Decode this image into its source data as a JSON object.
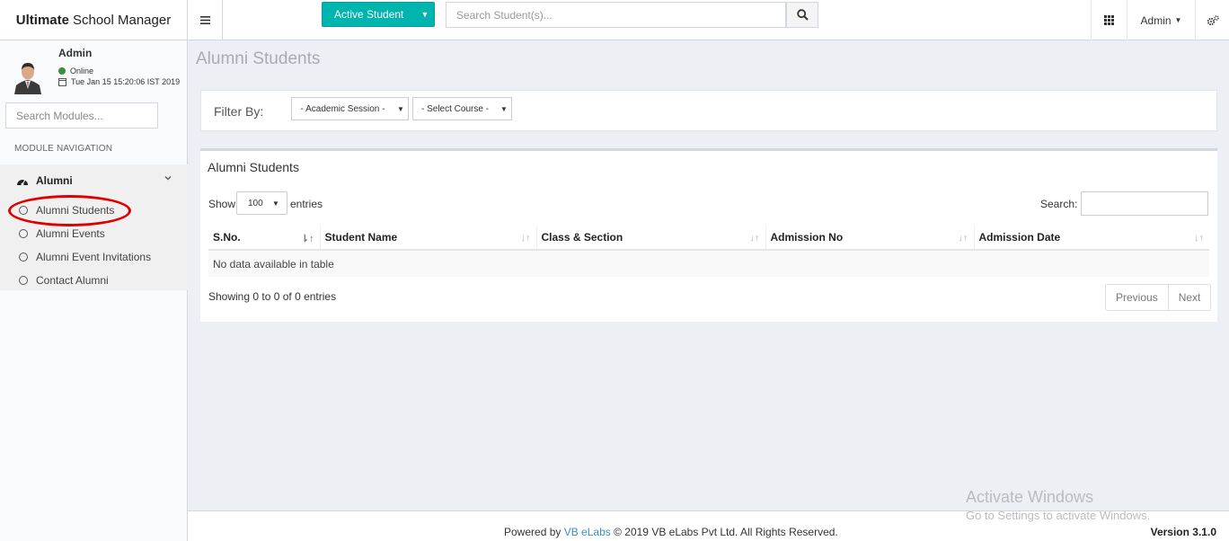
{
  "header": {
    "logo_bold": "Ultimate",
    "logo_rest": "School Manager",
    "active_student_label": "Active Student",
    "search_placeholder": "Search Student(s)...",
    "admin_label": "Admin"
  },
  "sidebar": {
    "user_name": "Admin",
    "user_status": "Online",
    "user_datetime": "Tue Jan 15 15:20:06 IST 2019",
    "search_placeholder": "Search Modules...",
    "section_label": "MODULE NAVIGATION",
    "group_label": "Alumni",
    "items": [
      {
        "label": "Alumni Students"
      },
      {
        "label": "Alumni Events"
      },
      {
        "label": "Alumni Event Invitations"
      },
      {
        "label": "Contact Alumni"
      }
    ]
  },
  "page": {
    "title": "Alumni Students",
    "filter_label": "Filter By:",
    "session_select": "- Academic Session -",
    "course_select": "- Select Course -"
  },
  "table": {
    "title": "Alumni Students",
    "show_label": "Show",
    "length_value": "100",
    "entries_label": "entries",
    "search_label": "Search:",
    "columns": [
      "S.No.",
      "Student Name",
      "Class & Section",
      "Admission No",
      "Admission Date"
    ],
    "empty_message": "No data available in table",
    "info": "Showing 0 to 0 of 0 entries",
    "prev_label": "Previous",
    "next_label": "Next"
  },
  "footer": {
    "powered_by": "Powered by",
    "company_link": "VB eLabs",
    "copyright": "© 2019 VB eLabs Pvt Ltd. All Rights Reserved.",
    "version": "Version 3.1.0"
  },
  "watermark": {
    "line1": "Activate Windows",
    "line2": "Go to Settings to activate Windows."
  },
  "colors": {
    "accent": "#00b5ad",
    "link": "#3c8dbc",
    "highlight": "#e00000"
  }
}
